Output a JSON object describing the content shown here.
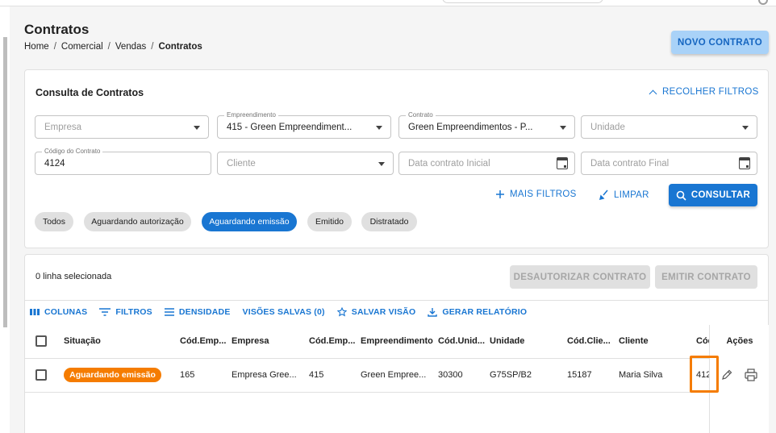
{
  "header": {
    "title": "Contratos",
    "breadcrumb": [
      "Home",
      "/",
      "Comercial",
      "/",
      "Vendas",
      "/",
      "Contratos"
    ],
    "new_button": "NOVO CONTRATO"
  },
  "filters": {
    "title": "Consulta de Contratos",
    "collapse_label": "RECOLHER FILTROS",
    "empresa": {
      "placeholder": "Empresa",
      "value": ""
    },
    "empreendimento": {
      "label": "Empreendimento",
      "value": "415 - Green Empreendiment..."
    },
    "contrato": {
      "label": "Contrato",
      "value": "Green Empreendimentos - P..."
    },
    "unidade": {
      "placeholder": "Unidade",
      "value": ""
    },
    "codigo_contrato": {
      "label": "Código do Contrato",
      "value": "4124"
    },
    "cliente": {
      "placeholder": "Cliente",
      "value": ""
    },
    "data_inicial": {
      "placeholder": "Data contrato Inicial"
    },
    "data_final": {
      "placeholder": "Data contrato Final"
    },
    "more_filters": "MAIS FILTROS",
    "clear": "LIMPAR",
    "search": "CONSULTAR",
    "chips": [
      {
        "label": "Todos",
        "active": false
      },
      {
        "label": "Aguardando autorização",
        "active": false
      },
      {
        "label": "Aguardando emissão",
        "active": true
      },
      {
        "label": "Emitido",
        "active": false
      },
      {
        "label": "Distratado",
        "active": false
      }
    ]
  },
  "grid": {
    "selection_text": "0 linha selecionada",
    "unauthorize_button": "DESAUTORIZAR CONTRATO",
    "emit_button": "EMITIR CONTRATO",
    "toolbar": [
      "COLUNAS",
      "FILTROS",
      "DENSIDADE",
      "VISÕES SALVAS (0)",
      "SALVAR VISÃO",
      "GERAR RELATÓRIO"
    ],
    "columns": [
      "Situação",
      "Cód.Emp...",
      "Empresa",
      "Cód.Emp...",
      "Empreendimento",
      "Cód.Unid...",
      "Unidade",
      "Cód.Clie...",
      "Cliente",
      "Cód",
      "Ações"
    ],
    "rows": [
      {
        "situacao": "Aguardando emissão",
        "cod_empresa": "165",
        "empresa": "Empresa Gree...",
        "cod_empreendimento": "415",
        "empreendimento": "Green Empree...",
        "cod_unidade": "30300",
        "unidade": "G75SP/B2",
        "cod_cliente": "15187",
        "cliente": "Maria Silva",
        "cod": "412"
      }
    ]
  },
  "colors": {
    "primary": "#1976d2",
    "accent": "#f57c00",
    "new_button_bg": "#a9d2f8"
  }
}
